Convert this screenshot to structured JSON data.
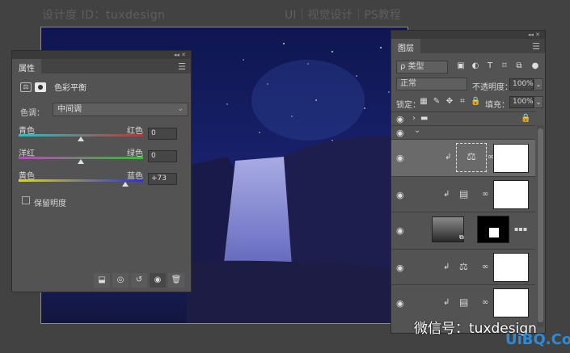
{
  "watermark": {
    "left": "设计度 ID：tuxdesign",
    "right": "UI｜视觉设计｜PS教程"
  },
  "properties": {
    "strip": "◂◂ ✕",
    "tab": "属性",
    "title": "色彩平衡",
    "tone_label": "色调：",
    "tone_value": "中间调",
    "sliders": [
      {
        "left": "青色",
        "right": "红色",
        "value": "0",
        "thumb_pct": 50,
        "gradient": [
          "#19c9c9",
          "#c83030"
        ]
      },
      {
        "left": "洋红",
        "right": "绿色",
        "value": "0",
        "thumb_pct": 50,
        "gradient": [
          "#c83cc8",
          "#22c822"
        ]
      },
      {
        "left": "黄色",
        "right": "蓝色",
        "value": "+73",
        "thumb_pct": 86,
        "gradient": [
          "#d8d820",
          "#2c2cd8"
        ]
      }
    ],
    "preserve_label": "保留明度",
    "footer_icons": [
      "clip-icon",
      "view-previous-icon",
      "reset-icon",
      "visibility-icon",
      "trash-icon"
    ]
  },
  "layers": {
    "strip": "◂◂ ✕",
    "tab": "图层",
    "kind_label": "ρ 类型",
    "blend_mode": "正常",
    "opacity_label": "不透明度：",
    "opacity_value": "100%",
    "lock_label": "锁定：",
    "fill_label": "填充：",
    "fill_value": "100%"
  },
  "overlays": {
    "wechat": "微信号：tuxdesign",
    "site": "UiBQ.CoM"
  },
  "colors": {
    "panel": "#535353",
    "dark": "#424242",
    "accent": "#2a8bd8"
  }
}
